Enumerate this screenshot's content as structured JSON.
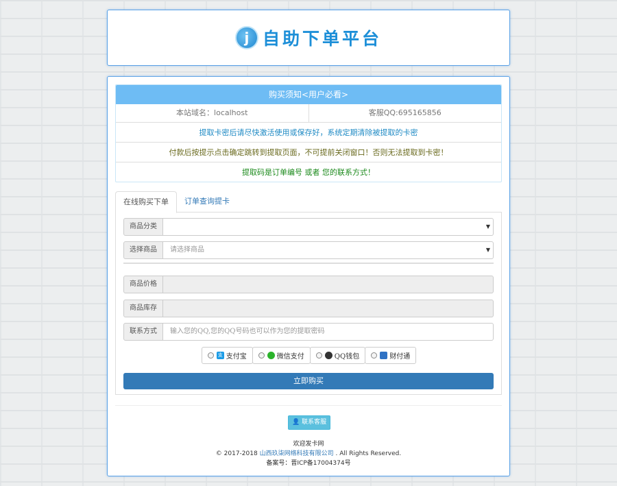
{
  "logo": {
    "mark": "j",
    "text": "自助下单平台"
  },
  "notice": {
    "title": "购买须知<用户必看>",
    "domain_label": "本站域名：localhost",
    "qq_label": "客服QQ:695165856",
    "line1": "提取卡密后请尽快激活使用或保存好，系统定期清除被提取的卡密",
    "line2": "付款后按提示点击确定跳转到提取页面，不可提前关闭窗口！否则无法提取到卡密！",
    "line3": "提取码是订单编号 或者 您的联系方式！"
  },
  "tabs": [
    "在线购买下单",
    "订单查询提卡"
  ],
  "form": {
    "category_label": "商品分类",
    "category_value": "",
    "product_label": "选择商品",
    "product_value": "请选择商品",
    "price_label": "商品价格",
    "stock_label": "商品库存",
    "contact_label": "联系方式",
    "contact_placeholder": "输入您的QQ,您的QQ号码也可以作为您的提取密码"
  },
  "payments": [
    {
      "label": "支付宝",
      "icon": "alipay-icon",
      "color": "#1a9be6"
    },
    {
      "label": "微信支付",
      "icon": "wechat-icon",
      "color": "#2bb32b"
    },
    {
      "label": "QQ钱包",
      "icon": "qq-icon",
      "color": "#333333"
    },
    {
      "label": "财付通",
      "icon": "tenpay-icon",
      "color": "#2f72c4"
    }
  ],
  "buy_button": "立即购买",
  "contact_button": "联系客服",
  "footer": {
    "site_name": "欢迎发卡网",
    "copyright_prefix": "© 2017-2018",
    "company": "山西玖柒网络科技有限公司",
    "copyright_suffix": ". All Rights Reserved.",
    "icp": "备案号：晋ICP备17004374号"
  },
  "colors": {
    "accent": "#337ab7",
    "notice_header": "#6ebcf4",
    "panel_border": "#5aa1e6"
  }
}
